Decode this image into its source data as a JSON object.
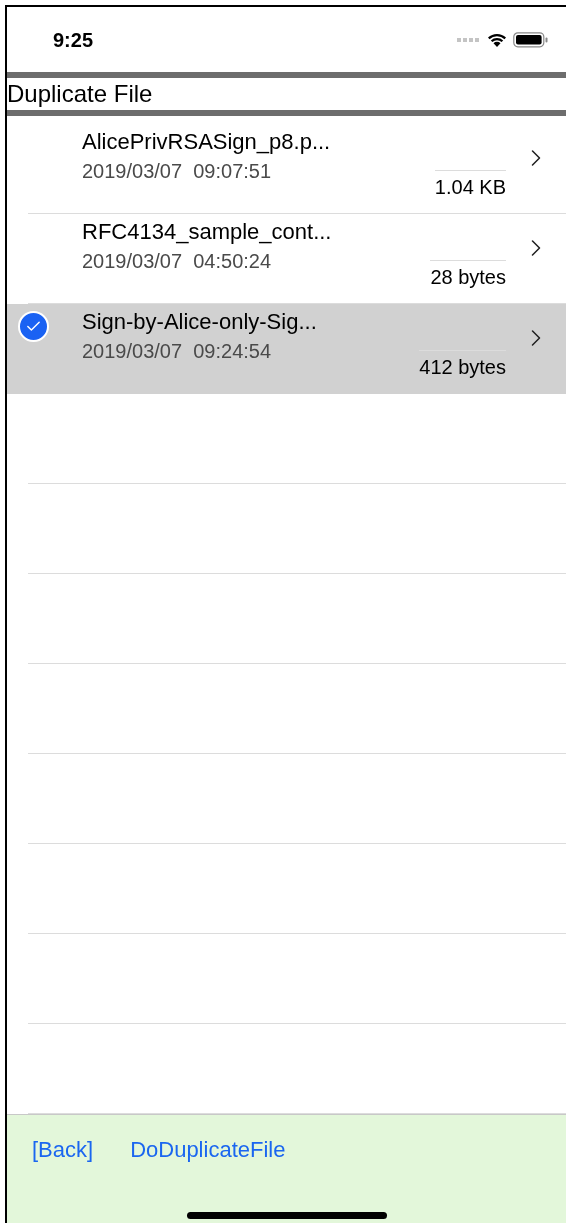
{
  "status_bar": {
    "time": "9:25"
  },
  "title": "Duplicate File",
  "files": [
    {
      "name": "AlicePrivRSASign_p8.p...",
      "date": "2019/03/07  09:07:51",
      "size": "1.04 KB",
      "selected": false
    },
    {
      "name": "RFC4134_sample_cont...",
      "date": "2019/03/07  04:50:24",
      "size": "28 bytes",
      "selected": false
    },
    {
      "name": "Sign-by-Alice-only-Sig...",
      "date": "2019/03/07  09:24:54",
      "size": "412 bytes",
      "selected": true
    }
  ],
  "toolbar": [
    "[Back]",
    "DoDuplicateFile"
  ]
}
